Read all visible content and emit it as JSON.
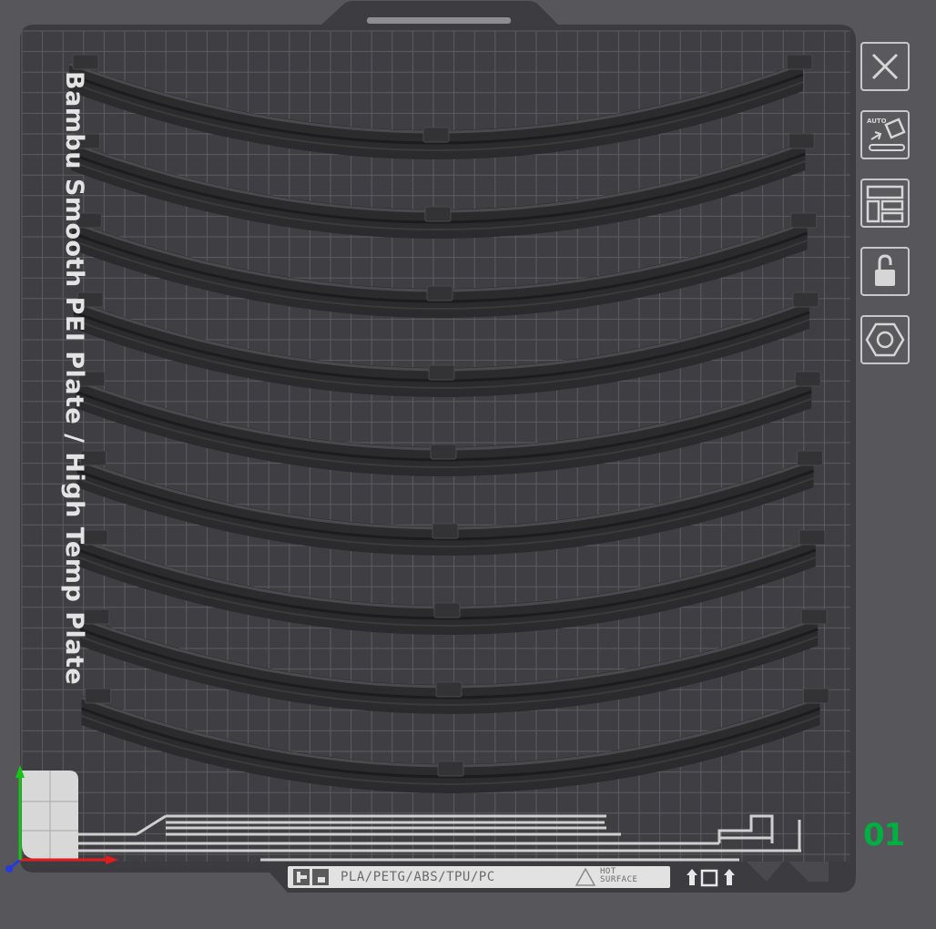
{
  "plate": {
    "name": "Bambu Smooth PEI Plate / High Temp Plate",
    "number": "01",
    "materials": "PLA/PETG/ABS/TPU/PC",
    "hot_line1": "HOT",
    "hot_line2": "SURFACE"
  },
  "toolbar": {
    "buttons": [
      {
        "name": "close-button",
        "icon": "close-icon"
      },
      {
        "name": "auto-orient-button",
        "icon": "auto-orient-icon",
        "label": "AUTO"
      },
      {
        "name": "arrange-button",
        "icon": "arrange-icon"
      },
      {
        "name": "lock-button",
        "icon": "lock-icon"
      },
      {
        "name": "plate-settings-button",
        "icon": "hexagon-settings-icon"
      }
    ]
  },
  "objects": {
    "count": 9,
    "type": "curved track segment"
  },
  "colors": {
    "background": "#57565b",
    "plate": "#3a3a3e",
    "grid": "#5c5c62",
    "part": "#2b2b2d",
    "plate_number": "#00ae42",
    "axis_x": "#e11d1d",
    "axis_y": "#18c318",
    "axis_z": "#2a3ad8"
  }
}
